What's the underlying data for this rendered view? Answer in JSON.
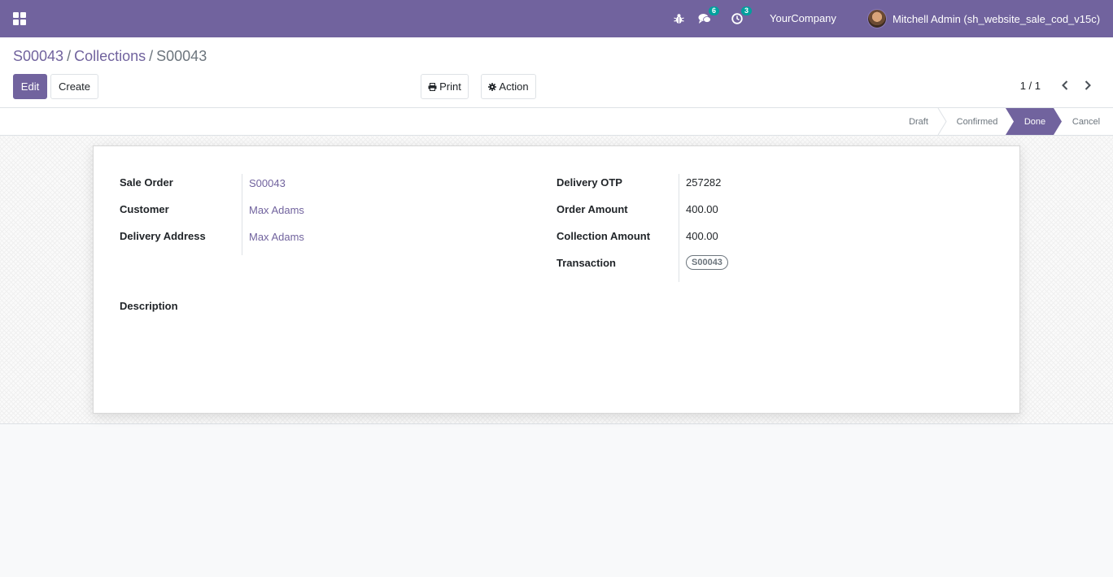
{
  "navbar": {
    "messages_badge": "6",
    "activities_badge": "3",
    "company": "YourCompany",
    "user": "Mitchell Admin (sh_website_sale_cod_v15c)",
    "icons": [
      "apps-icon",
      "bug-icon",
      "chat-icon",
      "clock-icon"
    ]
  },
  "breadcrumb": {
    "item1": "S00043",
    "sep1": "/",
    "item2": "Collections",
    "sep2": "/",
    "current": "S00043"
  },
  "buttons": {
    "edit": "Edit",
    "create": "Create",
    "print": "Print",
    "action": "Action"
  },
  "pager": {
    "value": "1 / 1"
  },
  "statusbar": {
    "stages": [
      "Draft",
      "Confirmed",
      "Done",
      "Cancel"
    ],
    "active": "Done"
  },
  "form": {
    "left": [
      {
        "label": "Sale Order",
        "value": "S00043"
      },
      {
        "label": "Customer",
        "value": "Max Adams"
      },
      {
        "label": "Delivery Address",
        "value": "Max Adams"
      }
    ],
    "right": [
      {
        "label": "Delivery OTP",
        "value": "257282"
      },
      {
        "label": "Order Amount",
        "value": "400.00"
      },
      {
        "label": "Collection Amount",
        "value": "400.00"
      },
      {
        "label": "Transaction",
        "value": "S00043"
      }
    ],
    "description_label": "Description"
  },
  "colors": {
    "brand": "#71639e",
    "badge": "#00a09d"
  }
}
